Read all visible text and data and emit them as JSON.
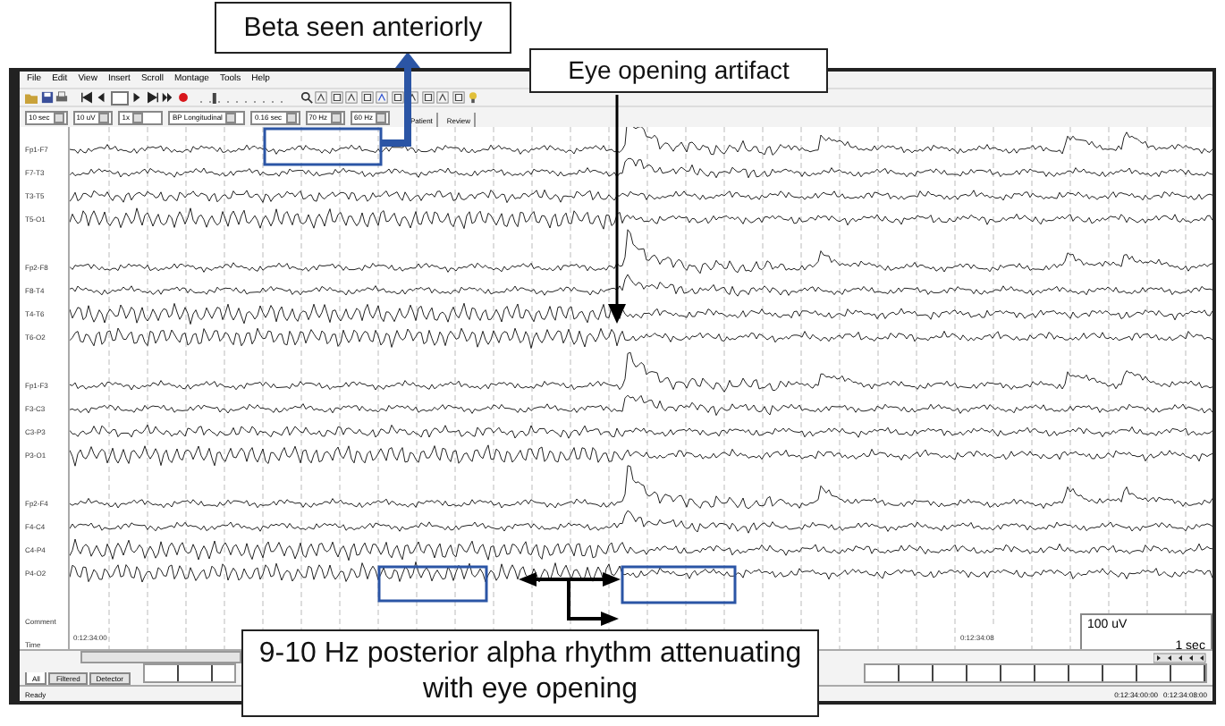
{
  "menu": [
    "File",
    "Edit",
    "View",
    "Insert",
    "Scroll",
    "Montage",
    "Tools",
    "Help"
  ],
  "playback_slider": {
    "level": 0.15
  },
  "dropdowns": [
    "10 sec",
    "10 uV",
    "1x",
    "BP Longitudinal",
    "0.16 sec",
    "70 Hz",
    "60 Hz"
  ],
  "view_tabs": [
    {
      "label": "Patient",
      "selected": false
    },
    {
      "label": "Review",
      "selected": false
    }
  ],
  "channel_groups": [
    [
      "Fp1-F7",
      "F7-T3",
      "T3-T5",
      "T5-O1"
    ],
    [
      "Fp2-F8",
      "F8-T4",
      "T4-T6",
      "T6-O2"
    ],
    [
      "Fp1-F3",
      "F3-C3",
      "C3-P3",
      "P3-O1"
    ],
    [
      "Fp2-F4",
      "F4-C4",
      "C4-P4",
      "P4-O2"
    ]
  ],
  "comment_label": "Comment",
  "time_label": "Time",
  "times": [
    "0:12:34:00",
    "0:12:34:08"
  ],
  "scale": {
    "amplitude": "100 uV",
    "duration": "1 sec"
  },
  "bottom_tabs": [
    {
      "label": "All",
      "selected": true
    },
    {
      "label": "Filtered",
      "selected": false
    },
    {
      "label": "Detector",
      "selected": false
    }
  ],
  "status": {
    "text": "Ready",
    "times": [
      "0:12:34:00:00",
      "0:12:34:08:00"
    ]
  },
  "annotations": {
    "beta": "Beta seen anteriorly",
    "eye": "Eye opening artifact",
    "alpha": "9-10 Hz posterior alpha rhythm attenuating with eye opening"
  }
}
